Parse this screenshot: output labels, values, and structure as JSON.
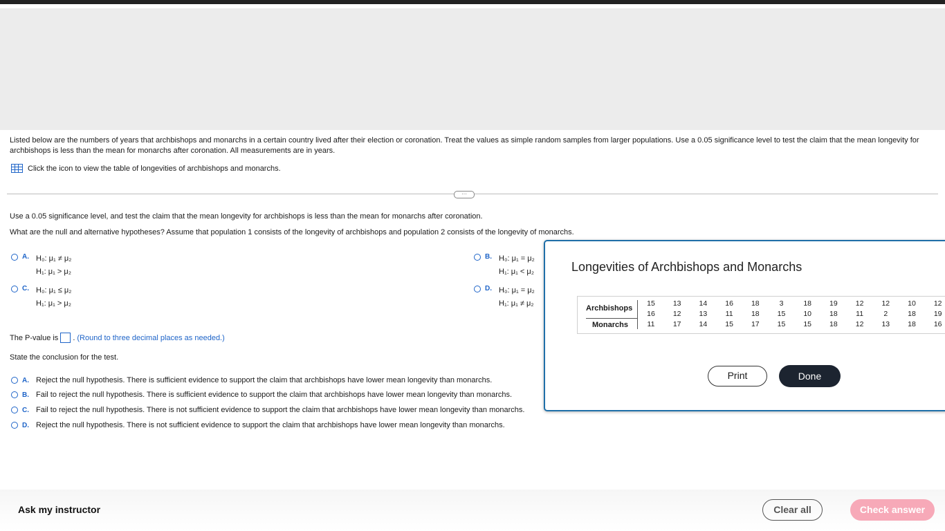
{
  "intro": {
    "text": "Listed below are the numbers of years that archbishops and monarchs in a certain country lived after their election or coronation. Treat the values as simple random samples from larger populations. Use a 0.05 significance level to test the claim that the mean longevity for archbishops is less than the mean for monarchs after coronation. All measurements are in years.",
    "table_link": "Click the icon to view the table of longevities of archbishops and monarchs."
  },
  "divider_handle": "···",
  "question": {
    "line1": "Use a 0.05 significance level, and test the claim that the mean longevity for archbishops is less than the mean for monarchs after coronation.",
    "line2": "What are the null and alternative hypotheses? Assume that population 1 consists of the longevity of archbishops and population 2 consists of the longevity of monarchs."
  },
  "hypotheses": [
    {
      "letter": "A.",
      "h0": "H₀: μ₁ ≠ μ₂",
      "h1": "H₁: μ₁ > μ₂"
    },
    {
      "letter": "B.",
      "h0": "H₀: μ₁ = μ₂",
      "h1": "H₁: μ₁ < μ₂"
    },
    {
      "letter": "C.",
      "h0": "H₀: μ₁ ≤ μ₂",
      "h1": "H₁: μ₁ > μ₂"
    },
    {
      "letter": "D.",
      "h0": "H₀: μ₁ = μ₂",
      "h1": "H₁: μ₁ ≠ μ₂"
    }
  ],
  "pvalue": {
    "label": "The P-value is",
    "suffix": ".",
    "hint": "(Round to three decimal places as needed.)",
    "value": ""
  },
  "conclusion_prompt": "State the conclusion for the test.",
  "conclusions": [
    {
      "letter": "A.",
      "text": "Reject the null hypothesis. There is sufficient evidence to support the claim that  archbishops have lower mean longevity than monarchs."
    },
    {
      "letter": "B.",
      "text": "Fail to reject the null hypothesis. There is sufficient evidence to support the claim that  archbishops have lower mean longevity than monarchs."
    },
    {
      "letter": "C.",
      "text": "Fail to reject the null hypothesis. There is not sufficient evidence to support the claim that archbishops have lower mean longevity than monarchs."
    },
    {
      "letter": "D.",
      "text": "Reject the null hypothesis. There is not sufficient evidence to support the claim that  archbishops have lower mean longevity than monarchs."
    }
  ],
  "popup": {
    "title": "Longevities of Archbishops and Monarchs",
    "row_labels": [
      "Archbishops",
      "Monarchs"
    ],
    "archbishops": [
      [
        15,
        16
      ],
      [
        13,
        12
      ],
      [
        14,
        13
      ],
      [
        16,
        11
      ],
      [
        18,
        18
      ],
      [
        3,
        15
      ],
      [
        18,
        10
      ],
      [
        19,
        18
      ],
      [
        12,
        11
      ],
      [
        12,
        2
      ],
      [
        10,
        18
      ],
      [
        12,
        19
      ]
    ],
    "monarchs": [
      11,
      17,
      14,
      15,
      17,
      15,
      15,
      18,
      12,
      13,
      18,
      16
    ],
    "print_label": "Print",
    "done_label": "Done"
  },
  "footer": {
    "ask_label": "Ask my instructor",
    "clear_label": "Clear all",
    "check_label": "Check answer"
  },
  "colors": {
    "accent": "#1e64c8",
    "popup_border": "#1f6fa8",
    "done_bg": "#1c2430",
    "check_bg": "#f7a9b8"
  }
}
